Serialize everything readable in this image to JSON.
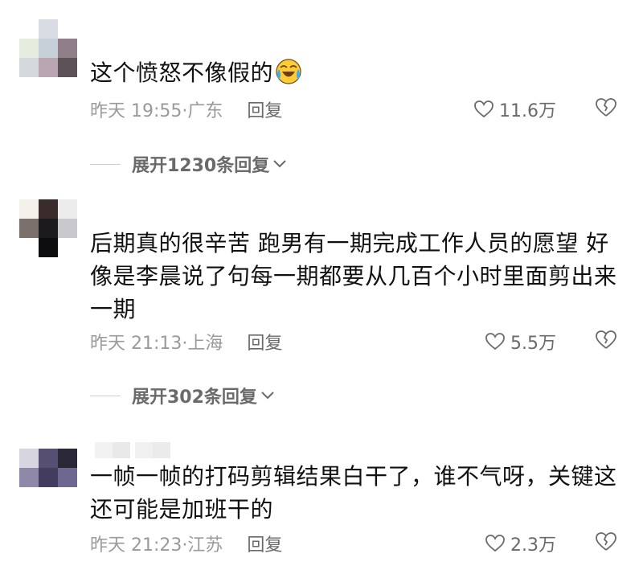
{
  "comments": [
    {
      "text": "这个愤怒不像假的",
      "emoji": "laughing-crying-emoji",
      "time": "昨天 19:55",
      "location": "广东",
      "reply_label": "回复",
      "likes": "11.6万",
      "expand_label": "展开1230条回复"
    },
    {
      "text": "后期真的很辛苦 跑男有一期完成工作人员的愿望 好像是李晨说了句每一期都要从几百个小时里面剪出来一期",
      "time": "昨天 21:13",
      "location": "上海",
      "reply_label": "回复",
      "likes": "5.5万",
      "expand_label": "展开302条回复"
    },
    {
      "text": "一帧一帧的打码剪辑结果白干了，谁不气呀，关键这还可能是加班干的",
      "time": "昨天 21:23",
      "location": "江苏",
      "reply_label": "回复",
      "likes": "2.3万"
    }
  ],
  "icons": {
    "like": "heart-outline-icon",
    "dislike": "broken-heart-icon",
    "expand": "chevron-down-icon"
  },
  "colors": {
    "text": "#111111",
    "meta": "#9a9a9a",
    "action": "#6a6a6a",
    "divider": "#cfcfcf"
  }
}
